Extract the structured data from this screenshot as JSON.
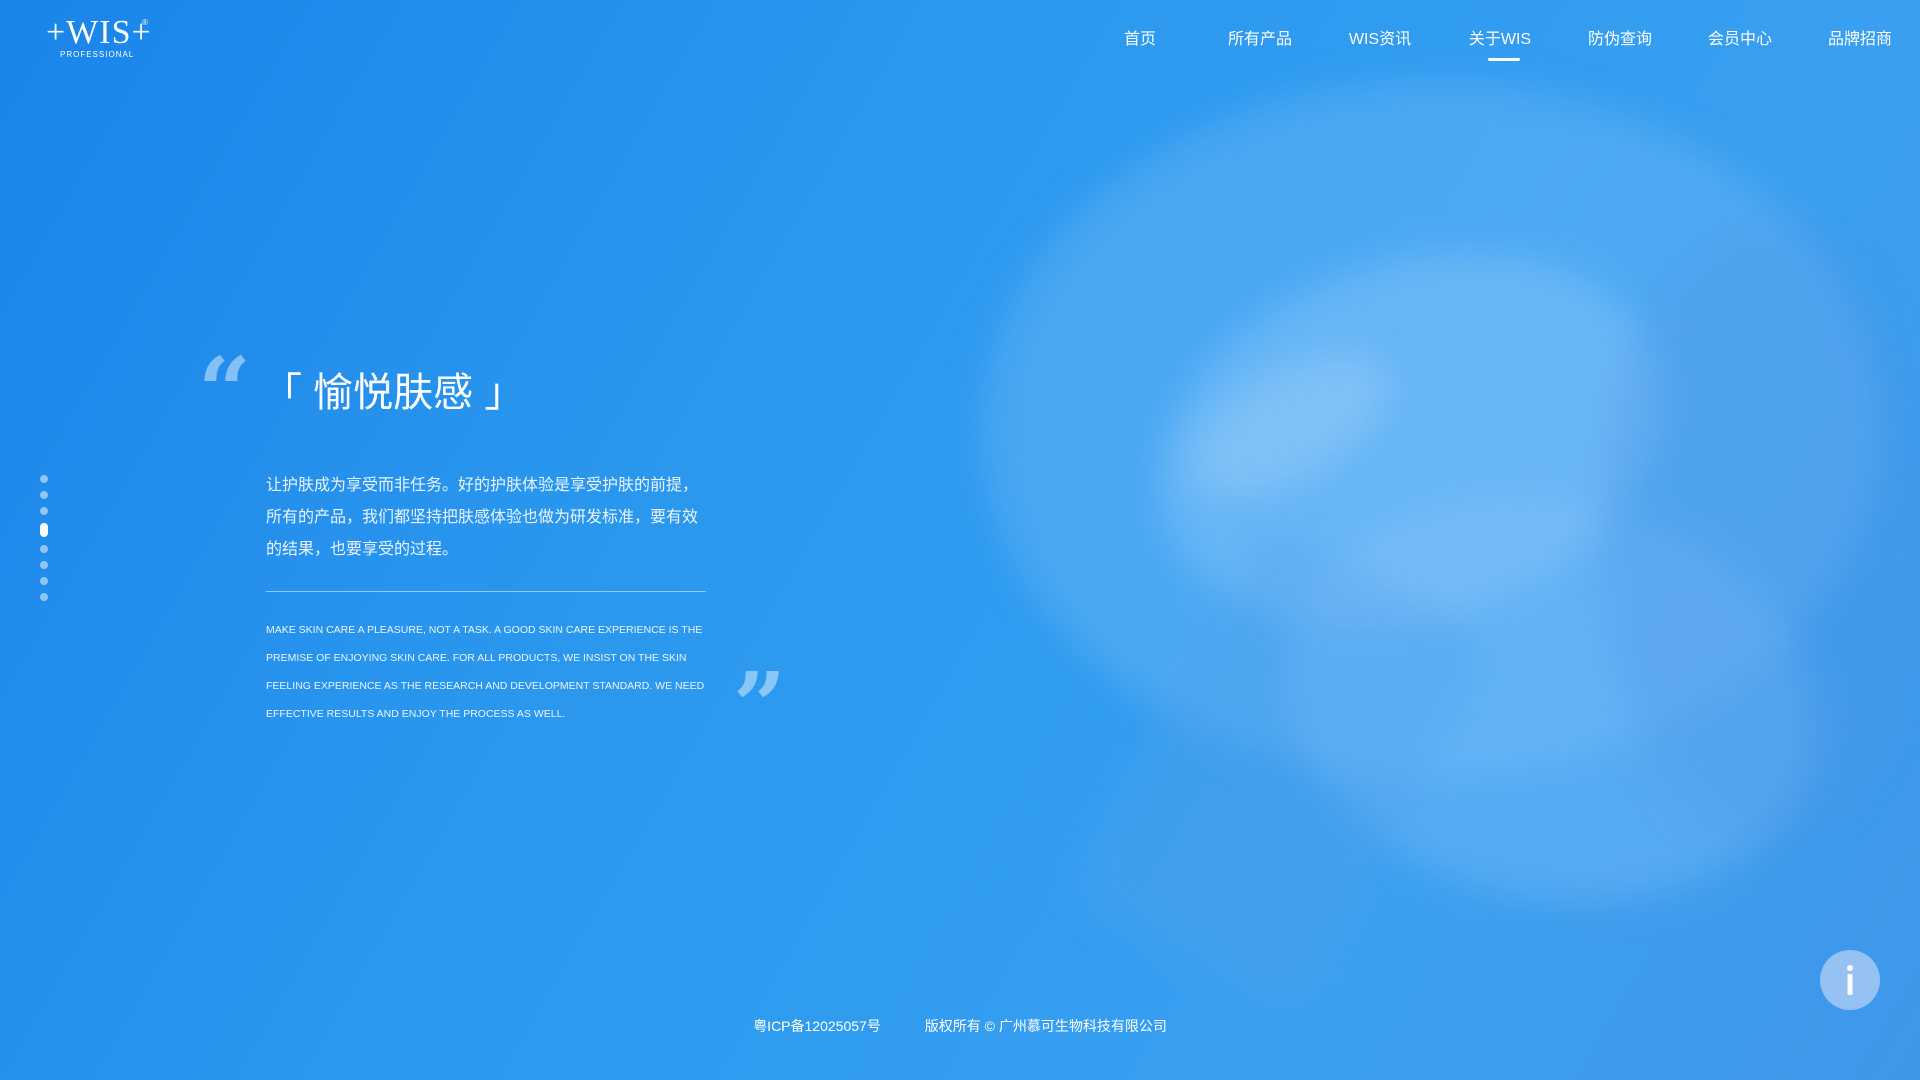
{
  "header": {
    "logo": {
      "text": "+WIS+",
      "sub": "PROFESSIONAL",
      "reg": "®"
    },
    "nav": [
      {
        "label": "首页"
      },
      {
        "label": "所有产品"
      },
      {
        "label": "WIS资讯"
      },
      {
        "label": "关于WIS",
        "active": true
      },
      {
        "label": "防伪查询"
      },
      {
        "label": "会员中心"
      },
      {
        "label": "品牌招商"
      }
    ]
  },
  "sidebar": {
    "dot_count": 8,
    "active_index": 3
  },
  "main": {
    "quote_open": "“",
    "quote_close": "”",
    "title": "「 愉悦肤感 」",
    "desc_cn": "让护肤成为享受而非任务。好的护肤体验是享受护肤的前提，所有的产品，我们都坚持把肤感体验也做为研发标准，要有效的结果，也要享受的过程。",
    "desc_en": "MAKE SKIN CARE A PLEASURE, NOT A TASK. A GOOD SKIN CARE EXPERIENCE IS THE PREMISE OF ENJOYING SKIN CARE. FOR ALL PRODUCTS, WE INSIST ON THE SKIN FEELING EXPERIENCE AS THE RESEARCH AND DEVELOPMENT STANDARD. WE NEED EFFECTIVE RESULTS AND ENJOY THE PROCESS AS WELL."
  },
  "footer": {
    "icp": "粤ICP备12025057号",
    "copyright": "版权所有 © 广州慕可生物科技有限公司"
  },
  "info_button": {
    "icon": "info-icon"
  },
  "colors": {
    "accent": "#2a8fee",
    "text": "#ffffff"
  }
}
